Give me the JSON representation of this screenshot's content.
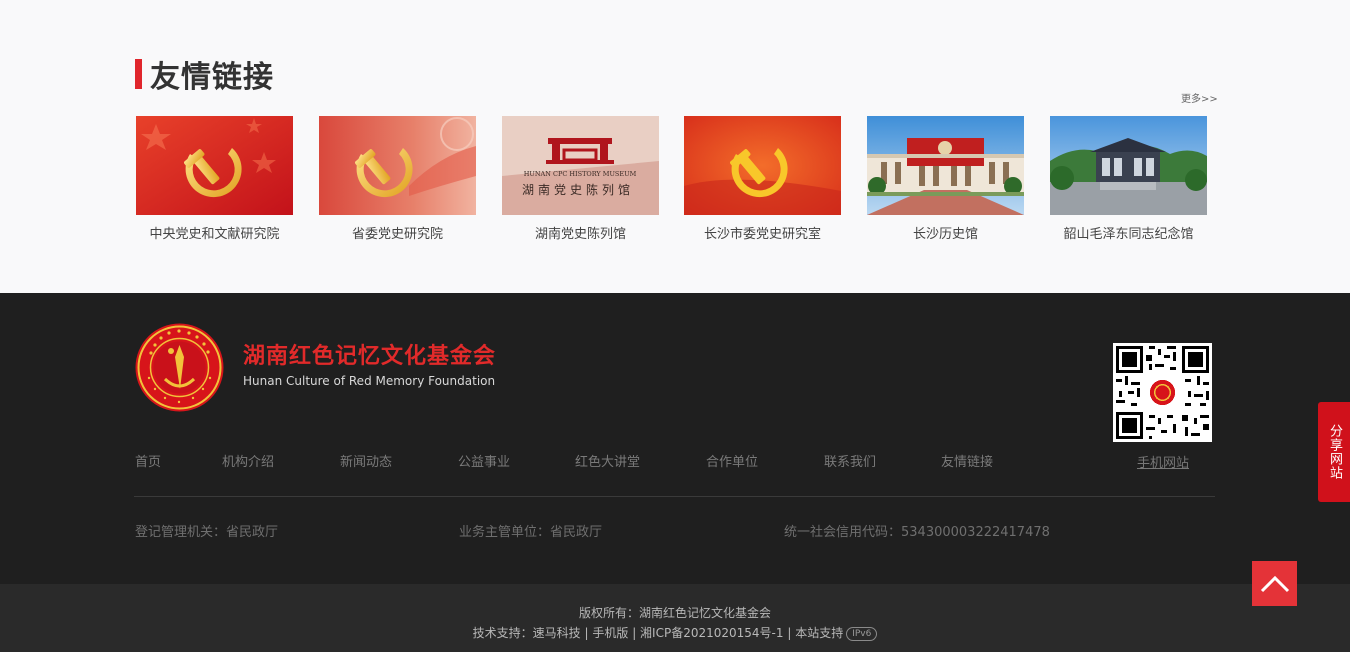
{
  "links": {
    "title": "友情链接",
    "more_label": "更多>>",
    "items": [
      {
        "label": "中央党史和文献研究院",
        "icon": "party-emblem-icon"
      },
      {
        "label": "省委党史研究院",
        "icon": "party-emblem-icon"
      },
      {
        "label": "湖南党史陈列馆",
        "icon": "museum-logo-icon",
        "thumb_text_en": "HUNAN CPC HISTORY MUSEUM",
        "thumb_text_cn": "湖南党史陈列馆"
      },
      {
        "label": "长沙市委党史研究室",
        "icon": "party-emblem-icon"
      },
      {
        "label": "长沙历史馆",
        "icon": "building-photo-icon"
      },
      {
        "label": "韶山毛泽东同志纪念馆",
        "icon": "building-photo-icon"
      }
    ]
  },
  "footer": {
    "name_cn": "湖南红色记忆文化基金会",
    "name_en": "Hunan Culture of Red Memory Foundation",
    "nav": [
      {
        "label": "首页"
      },
      {
        "label": "机构介绍"
      },
      {
        "label": "新闻动态"
      },
      {
        "label": "公益事业"
      },
      {
        "label": "红色大讲堂"
      },
      {
        "label": "合作单位"
      },
      {
        "label": "联系我们"
      },
      {
        "label": "友情链接"
      }
    ],
    "mobile_label": "手机网站",
    "registration": {
      "authority": "登记管理机关：省民政厅",
      "supervisor": "业务主管单位：省民政厅",
      "credit_code": "统一社会信用代码：534300003222417478"
    },
    "copyright": "版权所有：湖南红色记忆文化基金会",
    "tech_prefix": "技术支持：",
    "tech_vendor": "速马科技",
    "mobile_version": "手机版",
    "icp": "湘ICP备2021020154号-1",
    "site_support": "本站支持",
    "ipv6": "IPv6",
    "separator": " | "
  },
  "widgets": {
    "share_label": "分享网站",
    "back_top_icon": "chevron-up-icon"
  },
  "colors": {
    "accent_red": "#e0262c",
    "footer_bg": "#1f1f1f"
  }
}
